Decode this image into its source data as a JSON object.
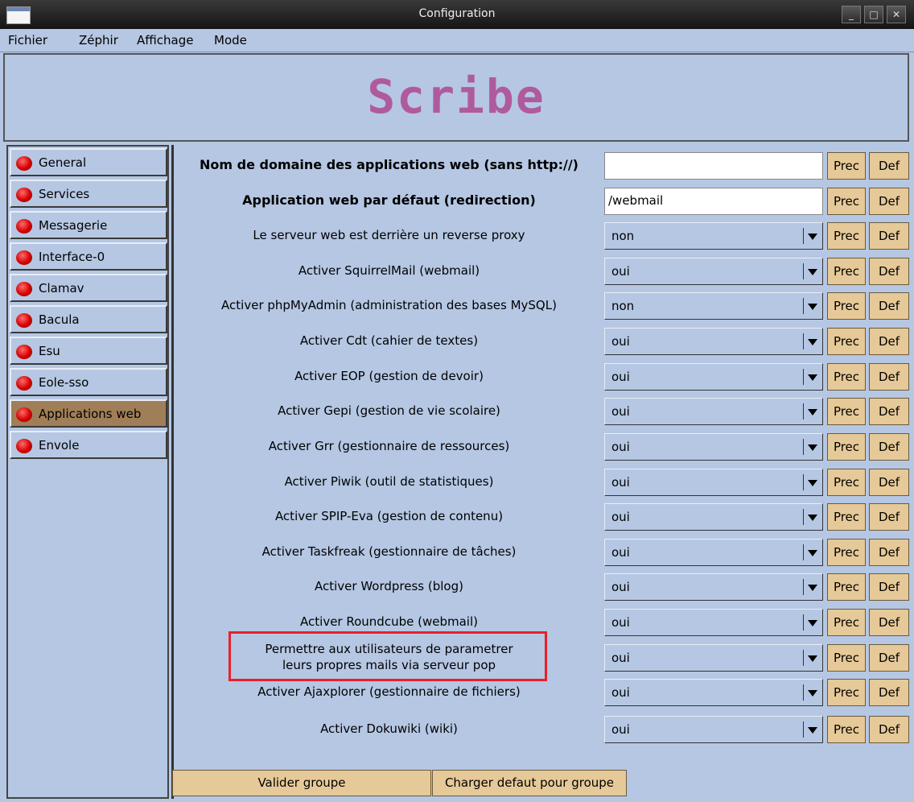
{
  "window": {
    "title": "Configuration",
    "buttons": [
      "_",
      "□",
      "✕"
    ]
  },
  "menu": [
    {
      "label": "Fichier"
    },
    {
      "label": "Zéphir"
    },
    {
      "label": "Affichage"
    },
    {
      "label": "Mode"
    }
  ],
  "banner": {
    "title": "Scribe"
  },
  "sidebar": {
    "active": "Applications web",
    "items": [
      {
        "label": "General"
      },
      {
        "label": "Services"
      },
      {
        "label": "Messagerie"
      },
      {
        "label": "Interface-0"
      },
      {
        "label": "Clamav"
      },
      {
        "label": "Bacula"
      },
      {
        "label": "Esu"
      },
      {
        "label": "Eole-sso"
      },
      {
        "label": "Applications web"
      },
      {
        "label": "Envole"
      }
    ]
  },
  "buttons": {
    "prec": "Prec",
    "def": "Def"
  },
  "rows": [
    {
      "label": "Nom de domaine des applications web (sans http://)",
      "value": "",
      "type": "text"
    },
    {
      "label": "Application web par défaut (redirection)",
      "value": "/webmail",
      "type": "text"
    },
    {
      "label": "Le serveur web est derrière un reverse proxy",
      "value": "non",
      "type": "select"
    },
    {
      "label": "Activer SquirrelMail (webmail)",
      "value": "oui",
      "type": "select"
    },
    {
      "label": "Activer phpMyAdmin (administration des bases MySQL)",
      "value": "non",
      "type": "select"
    },
    {
      "label": "Activer Cdt (cahier de textes)",
      "value": "oui",
      "type": "select"
    },
    {
      "label": "Activer EOP (gestion de devoir)",
      "value": "oui",
      "type": "select"
    },
    {
      "label": "Activer Gepi (gestion de vie scolaire)",
      "value": "oui",
      "type": "select"
    },
    {
      "label": "Activer Grr (gestionnaire de ressources)",
      "value": "oui",
      "type": "select"
    },
    {
      "label": "Activer Piwik (outil de statistiques)",
      "value": "oui",
      "type": "select"
    },
    {
      "label": "Activer SPIP-Eva (gestion de contenu)",
      "value": "oui",
      "type": "select"
    },
    {
      "label": "Activer Taskfreak (gestionnaire de tâches)",
      "value": "oui",
      "type": "select"
    },
    {
      "label": "Activer Wordpress (blog)",
      "value": "oui",
      "type": "select"
    },
    {
      "label": "Activer Roundcube (webmail)",
      "value": "oui",
      "type": "select"
    },
    {
      "label": "Permettre aux utilisateurs de parametrer\nleurs propres mails via serveur pop",
      "value": "oui",
      "type": "select"
    },
    {
      "label": "Activer Ajaxplorer (gestionnaire de fichiers)",
      "value": "oui",
      "type": "select"
    },
    {
      "label": "Activer Dokuwiki (wiki)",
      "value": "oui",
      "type": "select"
    }
  ],
  "footer": {
    "validate": "Valider groupe",
    "load_default": "Charger defaut pour groupe"
  },
  "colors": {
    "background": "#b5c7e3",
    "button": "#e6c998",
    "active_tab": "#a07e58",
    "brand": "#b05a9e",
    "status_led": "#d40000",
    "highlight": "#e8202a"
  }
}
